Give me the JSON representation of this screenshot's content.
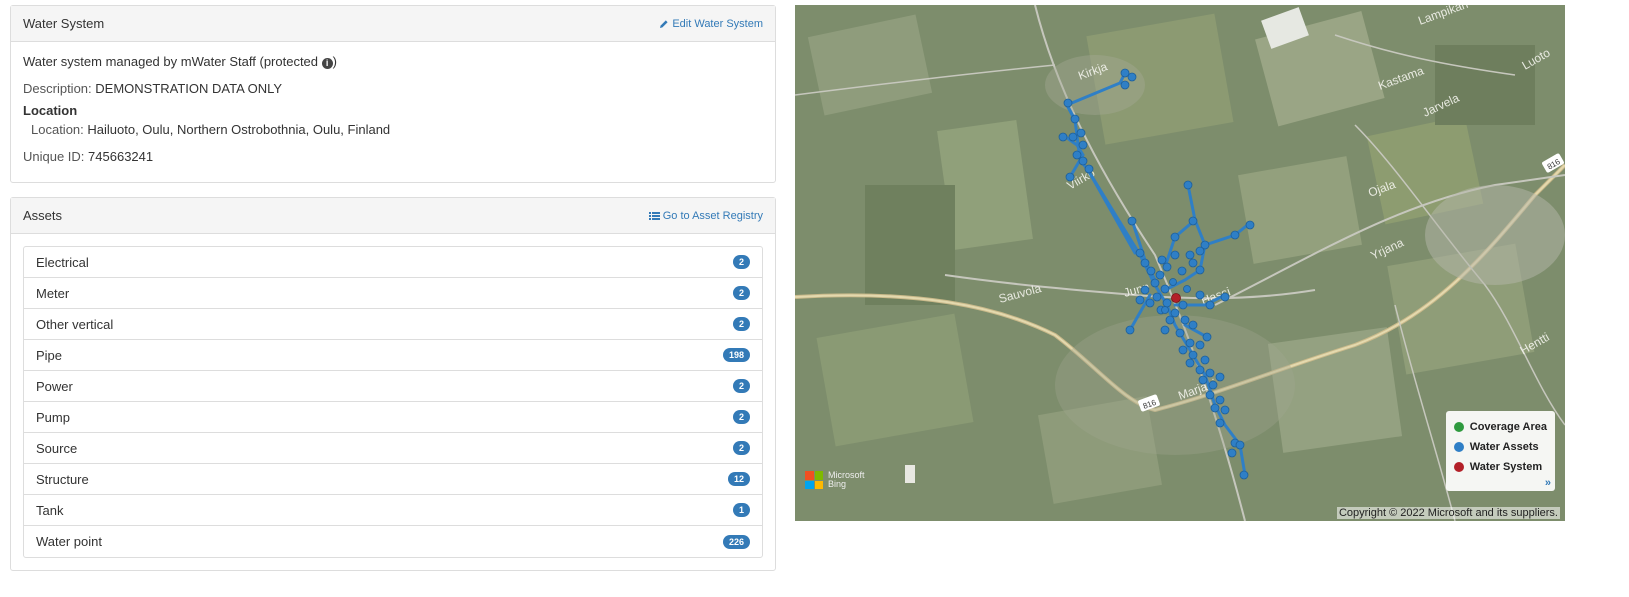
{
  "water_system": {
    "title": "Water System",
    "edit_label": "Edit Water System",
    "managed_prefix": "Water system managed by mWater Staff (protected ",
    "managed_suffix": ")",
    "description_label": "Description:",
    "description_value": "DEMONSTRATION DATA ONLY",
    "location_heading": "Location",
    "location_label": "Location:",
    "location_value": "Hailuoto, Oulu, Northern Ostrobothnia, Oulu, Finland",
    "unique_id_label": "Unique ID:",
    "unique_id_value": "745663241"
  },
  "assets": {
    "title": "Assets",
    "registry_label": "Go to Asset Registry",
    "items": [
      {
        "label": "Electrical",
        "count": "2"
      },
      {
        "label": "Meter",
        "count": "2"
      },
      {
        "label": "Other vertical",
        "count": "2"
      },
      {
        "label": "Pipe",
        "count": "198"
      },
      {
        "label": "Power",
        "count": "2"
      },
      {
        "label": "Pump",
        "count": "2"
      },
      {
        "label": "Source",
        "count": "2"
      },
      {
        "label": "Structure",
        "count": "12"
      },
      {
        "label": "Tank",
        "count": "1"
      },
      {
        "label": "Water point",
        "count": "226"
      }
    ]
  },
  "map": {
    "place_labels": [
      "Kirkja",
      "Viirko",
      "Sauvola",
      "Junn",
      "Hassi",
      "Marjani",
      "Kastama",
      "Lampikari",
      "Jarvela",
      "Ojala",
      "Yrjana",
      "Luoto",
      "Hentti"
    ],
    "road_number": "816",
    "legend": [
      {
        "label": "Coverage Area",
        "color": "#2e9a3e"
      },
      {
        "label": "Water Assets",
        "color": "#2f7fc6"
      },
      {
        "label": "Water System",
        "color": "#b32028"
      }
    ],
    "legend_toggle": "»",
    "logo_text_1": "Microsoft",
    "logo_text_2": "Bing",
    "copyright": "Copyright © 2022 Microsoft and its suppliers."
  }
}
